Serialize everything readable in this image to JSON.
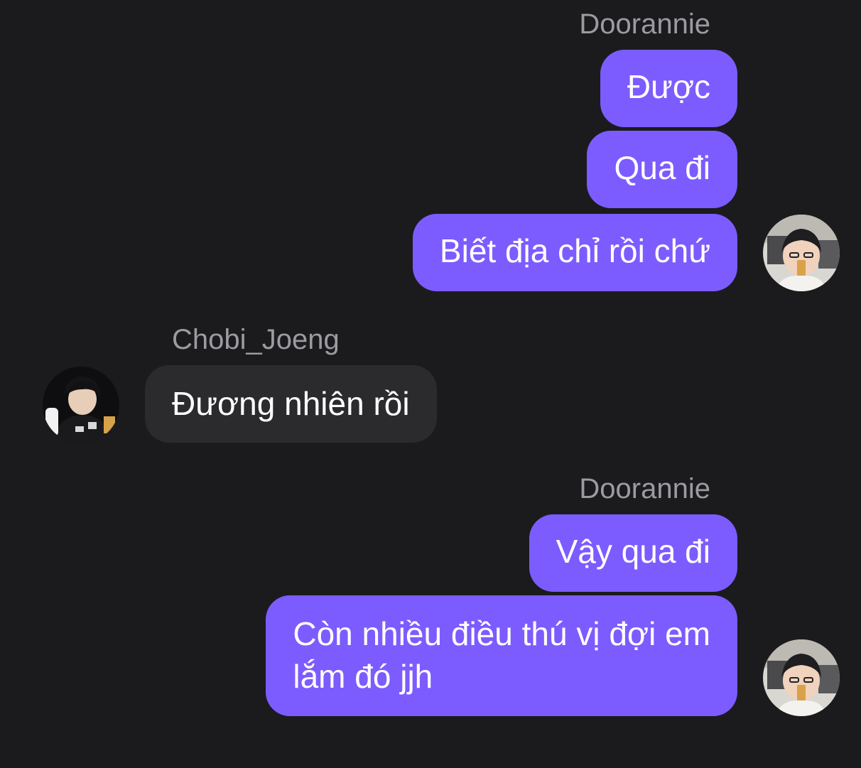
{
  "thread": {
    "groups": [
      {
        "sender": "Doorannie",
        "side": "outgoing",
        "messages": [
          "Được",
          "Qua đi",
          "Biết địa chỉ rồi chứ"
        ]
      },
      {
        "sender": "Chobi_Joeng",
        "side": "incoming",
        "messages": [
          "Đương nhiên rồi"
        ]
      },
      {
        "sender": "Doorannie",
        "side": "outgoing",
        "messages": [
          "Vậy qua đi",
          [
            "Còn nhiều điều thú vị đợi em",
            "lắm đó jjh"
          ]
        ]
      }
    ]
  },
  "colors": {
    "background": "#1b1b1d",
    "outgoing_bubble": "#7c5cff",
    "incoming_bubble": "#2b2b2e",
    "sender_name": "#9b9ba1"
  },
  "avatars": {
    "doorannie": "avatar-photo-doorannie",
    "chobi_joeng": "avatar-photo-chobi-joeng"
  }
}
